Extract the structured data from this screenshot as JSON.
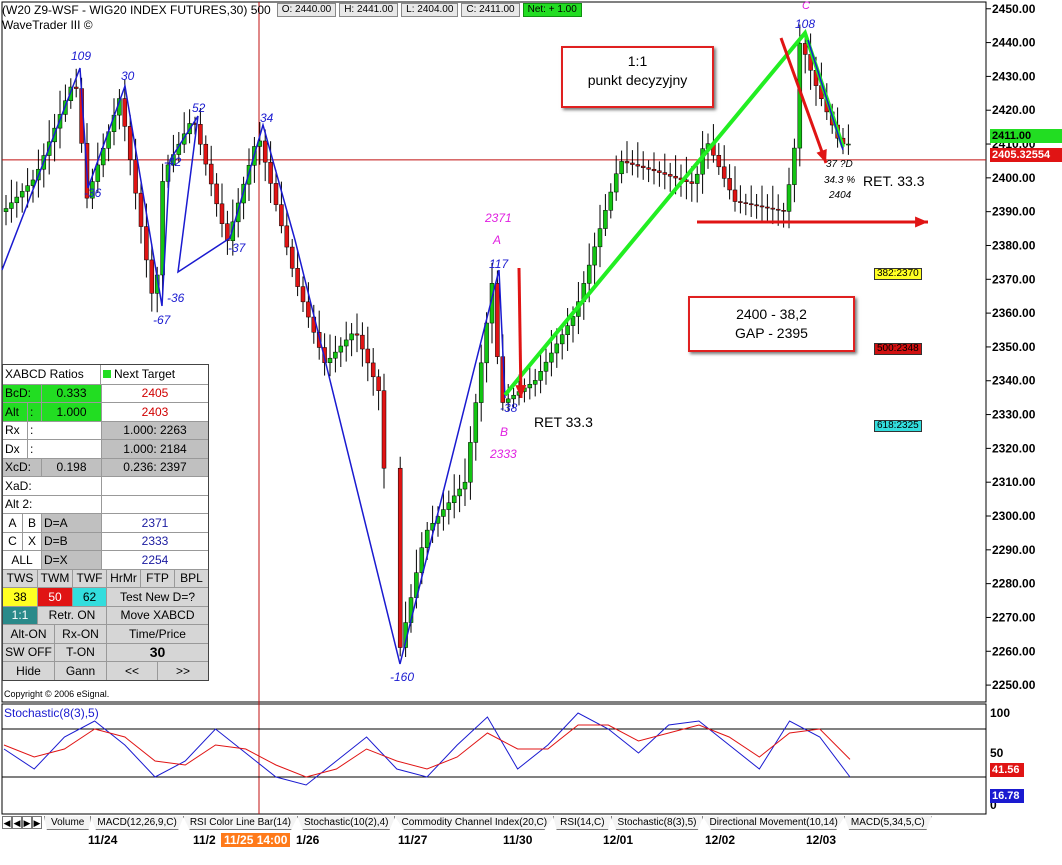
{
  "header": {
    "title": "(W20 Z9-WSF - WIG20 INDEX FUTURES,30) 500",
    "open": "O: 2440.00",
    "high": "H: 2441.00",
    "low": "L: 2404.00",
    "close": "C: 2411.00",
    "net": "Net: + 1.00",
    "subtitle": "WaveTrader III ©"
  },
  "callouts": {
    "c1_line1": "1:1",
    "c1_line2": "punkt decyzyjny",
    "c2_line1": "2400 - 38,2",
    "c2_line2": "GAP - 2395"
  },
  "annotations": {
    "ret1": "RET 33.3",
    "ret2": "RET. 33.3",
    "pctD": "34.3 %",
    "levelD": "2404",
    "labelD": "37 ?D",
    "labelA": "A",
    "labelB": "B",
    "labelC": "C",
    "valA": "2371",
    "valB": "2333"
  },
  "price_boxes": {
    "last": "2411.00",
    "cross": "2405.32554",
    "fib382": "382:2370",
    "fib500": "500:2348",
    "fib618": "618:2325",
    "stoch1": "41.56",
    "stoch2": "16.78"
  },
  "colors": {
    "wave": "#1a1ad0",
    "abcd": "#22ee22",
    "up": "#13c413",
    "down": "#e01414",
    "arrow": "#e01414",
    "fib382": "#ffff22",
    "fib500": "#d01010",
    "fib618": "#33dddd"
  },
  "panel": {
    "header": "XABCD Ratios",
    "next": "Next Target",
    "bcd_label": "BcD:",
    "bcd_val": "0.333",
    "bcd_target": "2405",
    "alt_label": "Alt",
    "alt_sep": ":",
    "alt_val": "1.000",
    "alt_target": "2403",
    "rx_label": "Rx",
    "rx_sep": ":",
    "rx_val": "1.000: 2263",
    "dx_label": "Dx",
    "dx_sep": ":",
    "dx_val": "1.000: 2184",
    "xcd_label": "XcD:",
    "xcd_val": "0.198",
    "xcd_target": "0.236: 2397",
    "xad_label": "XaD:",
    "alt2_label": "Alt 2:",
    "a": "A",
    "b": "B",
    "d_eq_a": "D=A",
    "d_eq_a_val": "2371",
    "c": "C",
    "x": "X",
    "d_eq_b": "D=B",
    "d_eq_b_val": "2333",
    "all": "ALL",
    "d_eq_x": "D=X",
    "d_eq_x_val": "2254",
    "tws": "TWS",
    "twm": "TWM",
    "twf": "TWF",
    "hrmr": "HrMr",
    "ftp": "FTP",
    "bpl": "BPL",
    "n38": "38",
    "n50": "50",
    "n62": "62",
    "testnew": "Test New D=?",
    "oneone": "1:1",
    "retr": "Retr. ON",
    "move": "Move XABCD",
    "alton": "Alt-ON",
    "rxon": "Rx-ON",
    "timeprice": "Time/Price",
    "swoff": "SW OFF",
    "ton": "T-ON",
    "thirty": "30",
    "hide": "Hide",
    "gann": "Gann",
    "prev": "<<",
    "next_btn": ">>",
    "copyright": "Copyright © 2006 eSignal."
  },
  "stoch_label": "Stochastic(8(3),5)",
  "tabs": [
    "Volume",
    "MACD(12,26,9,C)",
    "RSI Color Line Bar(14)",
    "Stochastic(10(2),4)",
    "Commodity Channel Index(20,C)",
    "RSI(14,C)",
    "Stochastic(8(3),5)",
    "Directional Movement(10,14)",
    "MACD(5,34,5,C)"
  ],
  "dates": [
    "11/24",
    "11/2",
    "11/25 14:00",
    "1/26",
    "11/27",
    "11/30",
    "12/01",
    "12/02",
    "12/03"
  ],
  "chart_data": {
    "type": "candlestick",
    "title": "(W20 Z9-WSF - WIG20 INDEX FUTURES,30) 500",
    "ylim": [
      2245,
      2452
    ],
    "yticks": [
      2250,
      2260,
      2270,
      2280,
      2290,
      2300,
      2310,
      2320,
      2330,
      2340,
      2350,
      2360,
      2370,
      2380,
      2390,
      2400,
      2410,
      2420,
      2430,
      2440,
      2450
    ],
    "stoch_ticks": [
      "100",
      "50",
      "0"
    ],
    "wave_points": [
      {
        "label": "109",
        "price": 2430
      },
      {
        "label": "-36",
        "price": 2394
      },
      {
        "label": "30",
        "price": 2424
      },
      {
        "label": "-67",
        "price": 2360
      },
      {
        "label": "-42",
        "price": 2401
      },
      {
        "label": "52",
        "price": 2418
      },
      {
        "label": "-36",
        "price": 2372
      },
      {
        "label": "-37",
        "price": 2381
      },
      {
        "label": "34",
        "price": 2413
      },
      {
        "label": "-160",
        "price": 2254
      },
      {
        "label": "117",
        "price": 2371
      },
      {
        "label": "-38",
        "price": 2333
      },
      {
        "label": "108",
        "price": 2441
      }
    ],
    "series": [
      {
        "name": "Stochastic(8(3),5)",
        "values": [
          55,
          30,
          70,
          90,
          60,
          20,
          40,
          80,
          50,
          20,
          10,
          40,
          70,
          30,
          20,
          60,
          95,
          30,
          60,
          100,
          80,
          50,
          85,
          90,
          60,
          30,
          90,
          70,
          20
        ]
      },
      {
        "name": "signal",
        "values": [
          60,
          45,
          55,
          80,
          70,
          40,
          35,
          60,
          55,
          35,
          20,
          30,
          55,
          40,
          30,
          45,
          75,
          55,
          55,
          85,
          85,
          65,
          75,
          85,
          70,
          45,
          75,
          80,
          42
        ]
      }
    ]
  }
}
